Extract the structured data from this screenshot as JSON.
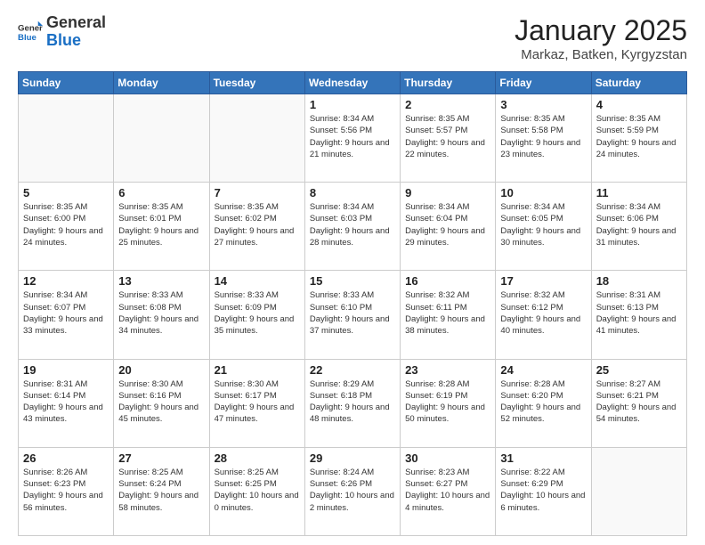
{
  "header": {
    "logo_general": "General",
    "logo_blue": "Blue",
    "month": "January 2025",
    "location": "Markaz, Batken, Kyrgyzstan"
  },
  "weekdays": [
    "Sunday",
    "Monday",
    "Tuesday",
    "Wednesday",
    "Thursday",
    "Friday",
    "Saturday"
  ],
  "weeks": [
    [
      {
        "day": "",
        "info": ""
      },
      {
        "day": "",
        "info": ""
      },
      {
        "day": "",
        "info": ""
      },
      {
        "day": "1",
        "info": "Sunrise: 8:34 AM\nSunset: 5:56 PM\nDaylight: 9 hours\nand 21 minutes."
      },
      {
        "day": "2",
        "info": "Sunrise: 8:35 AM\nSunset: 5:57 PM\nDaylight: 9 hours\nand 22 minutes."
      },
      {
        "day": "3",
        "info": "Sunrise: 8:35 AM\nSunset: 5:58 PM\nDaylight: 9 hours\nand 23 minutes."
      },
      {
        "day": "4",
        "info": "Sunrise: 8:35 AM\nSunset: 5:59 PM\nDaylight: 9 hours\nand 24 minutes."
      }
    ],
    [
      {
        "day": "5",
        "info": "Sunrise: 8:35 AM\nSunset: 6:00 PM\nDaylight: 9 hours\nand 24 minutes."
      },
      {
        "day": "6",
        "info": "Sunrise: 8:35 AM\nSunset: 6:01 PM\nDaylight: 9 hours\nand 25 minutes."
      },
      {
        "day": "7",
        "info": "Sunrise: 8:35 AM\nSunset: 6:02 PM\nDaylight: 9 hours\nand 27 minutes."
      },
      {
        "day": "8",
        "info": "Sunrise: 8:34 AM\nSunset: 6:03 PM\nDaylight: 9 hours\nand 28 minutes."
      },
      {
        "day": "9",
        "info": "Sunrise: 8:34 AM\nSunset: 6:04 PM\nDaylight: 9 hours\nand 29 minutes."
      },
      {
        "day": "10",
        "info": "Sunrise: 8:34 AM\nSunset: 6:05 PM\nDaylight: 9 hours\nand 30 minutes."
      },
      {
        "day": "11",
        "info": "Sunrise: 8:34 AM\nSunset: 6:06 PM\nDaylight: 9 hours\nand 31 minutes."
      }
    ],
    [
      {
        "day": "12",
        "info": "Sunrise: 8:34 AM\nSunset: 6:07 PM\nDaylight: 9 hours\nand 33 minutes."
      },
      {
        "day": "13",
        "info": "Sunrise: 8:33 AM\nSunset: 6:08 PM\nDaylight: 9 hours\nand 34 minutes."
      },
      {
        "day": "14",
        "info": "Sunrise: 8:33 AM\nSunset: 6:09 PM\nDaylight: 9 hours\nand 35 minutes."
      },
      {
        "day": "15",
        "info": "Sunrise: 8:33 AM\nSunset: 6:10 PM\nDaylight: 9 hours\nand 37 minutes."
      },
      {
        "day": "16",
        "info": "Sunrise: 8:32 AM\nSunset: 6:11 PM\nDaylight: 9 hours\nand 38 minutes."
      },
      {
        "day": "17",
        "info": "Sunrise: 8:32 AM\nSunset: 6:12 PM\nDaylight: 9 hours\nand 40 minutes."
      },
      {
        "day": "18",
        "info": "Sunrise: 8:31 AM\nSunset: 6:13 PM\nDaylight: 9 hours\nand 41 minutes."
      }
    ],
    [
      {
        "day": "19",
        "info": "Sunrise: 8:31 AM\nSunset: 6:14 PM\nDaylight: 9 hours\nand 43 minutes."
      },
      {
        "day": "20",
        "info": "Sunrise: 8:30 AM\nSunset: 6:16 PM\nDaylight: 9 hours\nand 45 minutes."
      },
      {
        "day": "21",
        "info": "Sunrise: 8:30 AM\nSunset: 6:17 PM\nDaylight: 9 hours\nand 47 minutes."
      },
      {
        "day": "22",
        "info": "Sunrise: 8:29 AM\nSunset: 6:18 PM\nDaylight: 9 hours\nand 48 minutes."
      },
      {
        "day": "23",
        "info": "Sunrise: 8:28 AM\nSunset: 6:19 PM\nDaylight: 9 hours\nand 50 minutes."
      },
      {
        "day": "24",
        "info": "Sunrise: 8:28 AM\nSunset: 6:20 PM\nDaylight: 9 hours\nand 52 minutes."
      },
      {
        "day": "25",
        "info": "Sunrise: 8:27 AM\nSunset: 6:21 PM\nDaylight: 9 hours\nand 54 minutes."
      }
    ],
    [
      {
        "day": "26",
        "info": "Sunrise: 8:26 AM\nSunset: 6:23 PM\nDaylight: 9 hours\nand 56 minutes."
      },
      {
        "day": "27",
        "info": "Sunrise: 8:25 AM\nSunset: 6:24 PM\nDaylight: 9 hours\nand 58 minutes."
      },
      {
        "day": "28",
        "info": "Sunrise: 8:25 AM\nSunset: 6:25 PM\nDaylight: 10 hours\nand 0 minutes."
      },
      {
        "day": "29",
        "info": "Sunrise: 8:24 AM\nSunset: 6:26 PM\nDaylight: 10 hours\nand 2 minutes."
      },
      {
        "day": "30",
        "info": "Sunrise: 8:23 AM\nSunset: 6:27 PM\nDaylight: 10 hours\nand 4 minutes."
      },
      {
        "day": "31",
        "info": "Sunrise: 8:22 AM\nSunset: 6:29 PM\nDaylight: 10 hours\nand 6 minutes."
      },
      {
        "day": "",
        "info": ""
      }
    ]
  ]
}
